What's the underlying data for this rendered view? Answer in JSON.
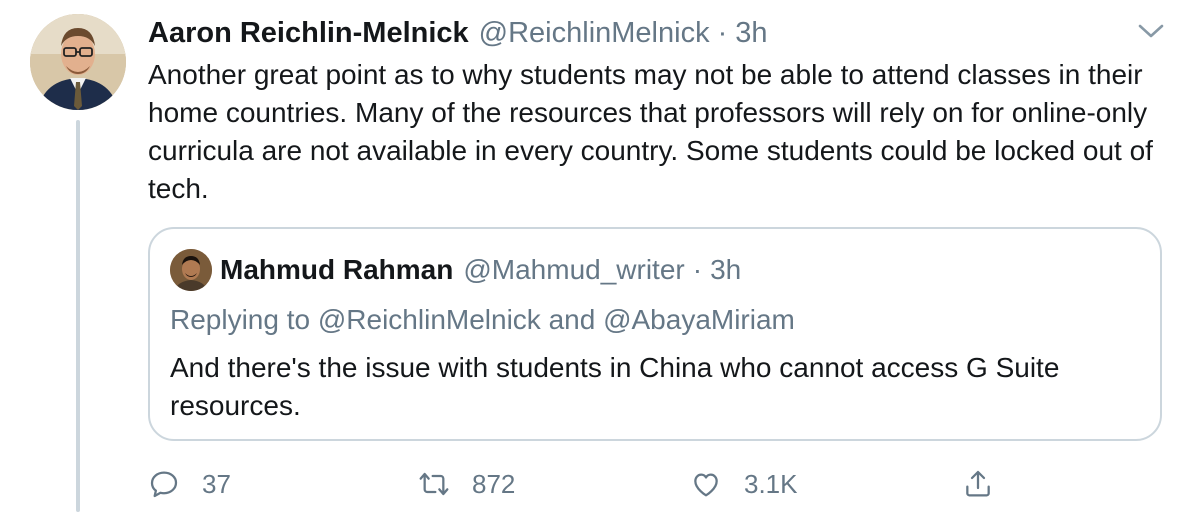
{
  "tweet": {
    "author": {
      "name": "Aaron Reichlin-Melnick",
      "handle": "@ReichlinMelnick"
    },
    "separator": "·",
    "time": "3h",
    "text": "Another great point as to why students may not be able to attend classes in their home countries. Many of the resources that professors will rely on for online-only curricula are not available in every country. Some students could be locked out of tech."
  },
  "quoted_tweet": {
    "author": {
      "name": "Mahmud Rahman",
      "handle": "@Mahmud_writer"
    },
    "separator": "·",
    "time": "3h",
    "replying_to": "Replying to @ReichlinMelnick and @AbayaMiriam",
    "text": "And there's the issue with students in China who cannot access G Suite resources."
  },
  "actions": {
    "reply_count": "37",
    "retweet_count": "872",
    "like_count": "3.1K"
  },
  "icons": {
    "reply": "reply-icon",
    "retweet": "retweet-icon",
    "like": "like-icon",
    "share": "share-icon",
    "menu": "chevron-down-icon"
  },
  "colors": {
    "text_primary": "#14171a",
    "text_secondary": "#657786",
    "border": "#ccd6dd"
  }
}
